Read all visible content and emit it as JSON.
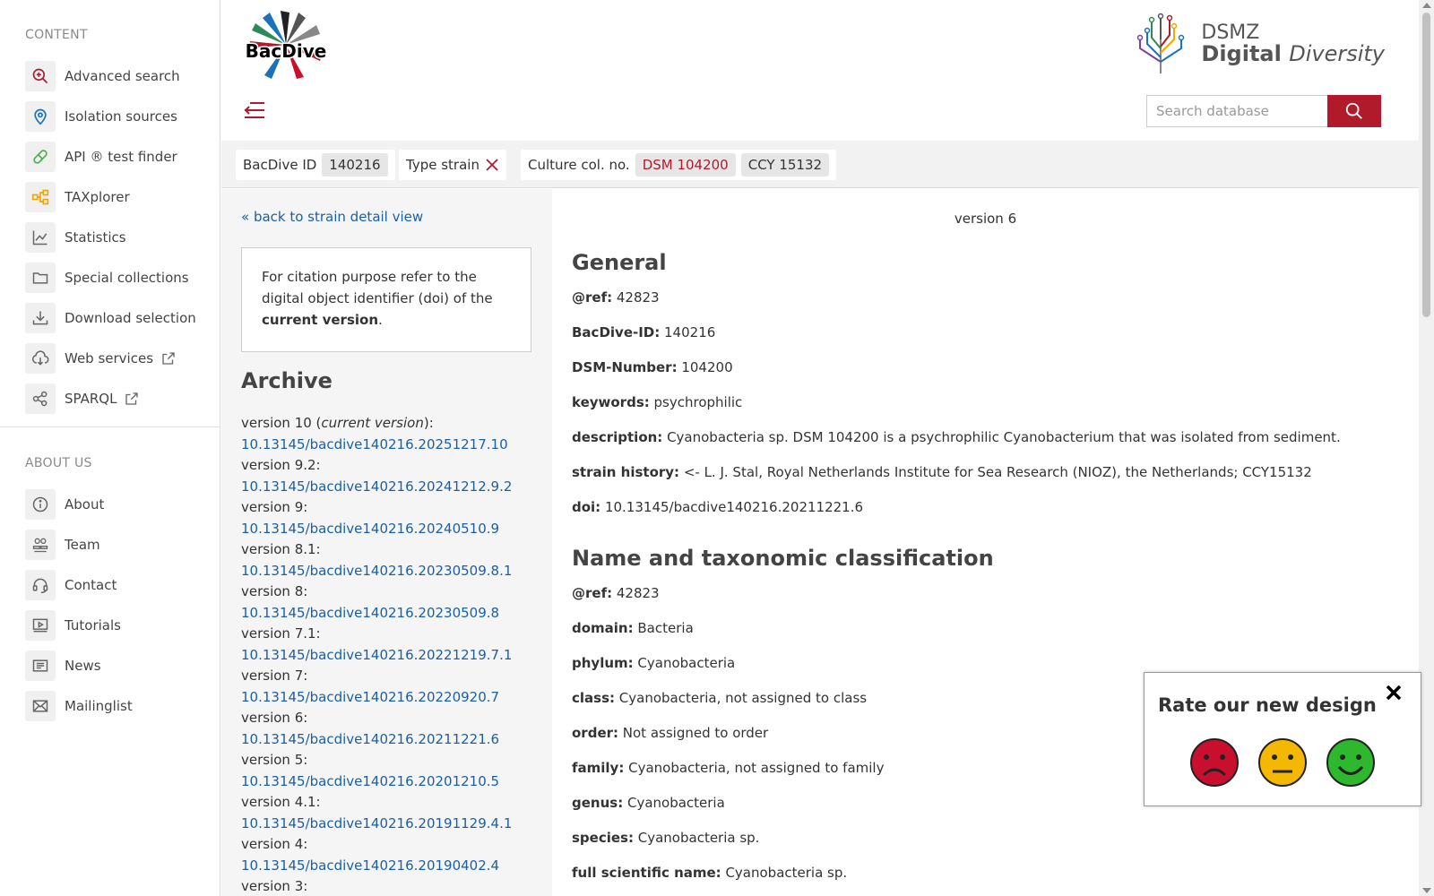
{
  "sidebar": {
    "content_title": "CONTENT",
    "content_items": [
      {
        "label": "Advanced search",
        "icon": "magnifier-plus-icon",
        "color": "#b01a2a"
      },
      {
        "label": "Isolation sources",
        "icon": "location-pin-icon",
        "color": "#1b72b8"
      },
      {
        "label": "API ® test finder",
        "icon": "pill-icon",
        "color": "#4caf50"
      },
      {
        "label": "TAXplorer",
        "icon": "hierarchy-icon",
        "color": "#f0a500"
      },
      {
        "label": "Statistics",
        "icon": "line-chart-icon",
        "color": "#666"
      },
      {
        "label": "Special collections",
        "icon": "folder-icon",
        "color": "#666"
      },
      {
        "label": "Download selection",
        "icon": "download-tray-icon",
        "color": "#666"
      },
      {
        "label": "Web services",
        "icon": "cloud-download-icon",
        "color": "#666",
        "external": true
      },
      {
        "label": "SPARQL",
        "icon": "nodes-icon",
        "color": "#666",
        "external": true
      }
    ],
    "about_title": "ABOUT US",
    "about_items": [
      {
        "label": "About",
        "icon": "info-circle-icon"
      },
      {
        "label": "Team",
        "icon": "team-icon"
      },
      {
        "label": "Contact",
        "icon": "headset-icon"
      },
      {
        "label": "Tutorials",
        "icon": "video-screen-icon"
      },
      {
        "label": "News",
        "icon": "newspaper-icon"
      },
      {
        "label": "Mailinglist",
        "icon": "envelope-icon"
      }
    ]
  },
  "header": {
    "logo_text": "BacDive",
    "dsmz_line1": "DSMZ",
    "dsmz_line2a": "Digital ",
    "dsmz_line2b": "Diversity",
    "search_placeholder": "Search database"
  },
  "tags": {
    "bacdive_id_label": "BacDive ID",
    "bacdive_id_value": "140216",
    "type_strain_label": "Type strain",
    "culture_label": "Culture col. no.",
    "culture_values": [
      "DSM 104200",
      "CCY 15132"
    ]
  },
  "left": {
    "back_link": "« back to strain detail view",
    "citation_pre": "For citation purpose refer to the digital object identifier (doi) of the ",
    "citation_bold": "current version",
    "citation_post": ".",
    "archive_title": "Archive",
    "archive": [
      {
        "version": "version 10 (",
        "current": "current version",
        "suffix": "):",
        "doi": "10.13145/bacdive140216.20251217.10"
      },
      {
        "version": "version 9.2:",
        "doi": "10.13145/bacdive140216.20241212.9.2"
      },
      {
        "version": "version 9:",
        "doi": "10.13145/bacdive140216.20240510.9"
      },
      {
        "version": "version 8.1:",
        "doi": "10.13145/bacdive140216.20230509.8.1"
      },
      {
        "version": "version 8:",
        "doi": "10.13145/bacdive140216.20230509.8"
      },
      {
        "version": "version 7.1:",
        "doi": "10.13145/bacdive140216.20221219.7.1"
      },
      {
        "version": "version 7:",
        "doi": "10.13145/bacdive140216.20220920.7"
      },
      {
        "version": "version 6:",
        "doi": "10.13145/bacdive140216.20211221.6"
      },
      {
        "version": "version 5:",
        "doi": "10.13145/bacdive140216.20201210.5"
      },
      {
        "version": "version 4.1:",
        "doi": "10.13145/bacdive140216.20191129.4.1"
      },
      {
        "version": "version 4:",
        "doi": "10.13145/bacdive140216.20190402.4"
      },
      {
        "version": "version 3:",
        "doi": ""
      }
    ]
  },
  "main": {
    "version_header": "version 6",
    "general_title": "General",
    "general": [
      {
        "k": "@ref:",
        "v": " 42823"
      },
      {
        "k": "BacDive-ID:",
        "v": " 140216"
      },
      {
        "k": "DSM-Number:",
        "v": " 104200"
      },
      {
        "k": "keywords:",
        "v": " psychrophilic"
      },
      {
        "k": "description:",
        "v": " Cyanobacteria sp. DSM 104200 is a psychrophilic Cyanobacterium that was isolated from sediment."
      },
      {
        "k": "strain history:",
        "v": " <- L. J. Stal, Royal Netherlands Institute for Sea Research (NIOZ), the Netherlands; CCY15132"
      },
      {
        "k": "doi:",
        "v": " 10.13145/bacdive140216.20211221.6"
      }
    ],
    "taxonomy_title": "Name and taxonomic classification",
    "taxonomy": [
      {
        "k": "@ref:",
        "v": " 42823"
      },
      {
        "k": "domain:",
        "v": " Bacteria"
      },
      {
        "k": "phylum:",
        "v": " Cyanobacteria"
      },
      {
        "k": "class:",
        "v": " Cyanobacteria, not assigned to class"
      },
      {
        "k": "order:",
        "v": " Not assigned to order"
      },
      {
        "k": "family:",
        "v": " Cyanobacteria, not assigned to family"
      },
      {
        "k": "genus:",
        "v": " Cyanobacteria"
      },
      {
        "k": "species:",
        "v": " Cyanobacteria sp."
      },
      {
        "k": "full scientific name:",
        "v": " Cyanobacteria sp."
      }
    ]
  },
  "rating": {
    "title": "Rate our new design",
    "faces": [
      {
        "name": "sad-face-icon",
        "color": "#c8102e"
      },
      {
        "name": "neutral-face-icon",
        "color": "#f5b800"
      },
      {
        "name": "happy-face-icon",
        "color": "#2eb82e"
      }
    ]
  },
  "colors": {
    "accent": "#b01a2a",
    "link": "#1b5fa5"
  }
}
